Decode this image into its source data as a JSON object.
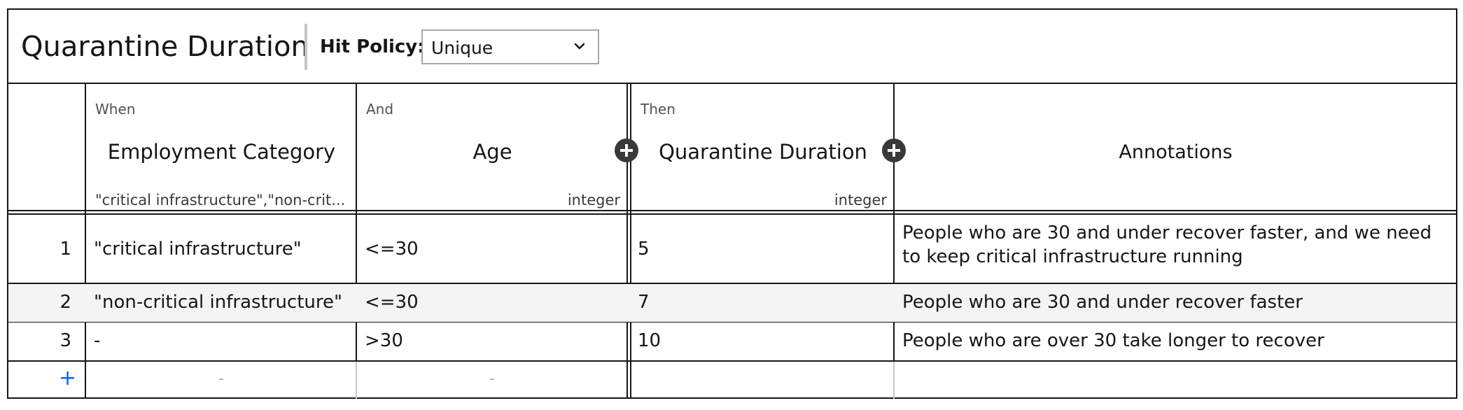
{
  "table_title": "Quarantine Duration",
  "hit_policy": {
    "label": "Hit Policy:",
    "value": "Unique"
  },
  "headers": {
    "when": {
      "label": "When",
      "name": "Employment Category",
      "type": "\"critical infrastructure\",\"non-crit..."
    },
    "and": {
      "label": "And",
      "name": "Age",
      "type": "integer"
    },
    "then": {
      "label": "Then",
      "name": "Quarantine Duration",
      "type": "integer"
    },
    "annotations": {
      "name": "Annotations"
    }
  },
  "rows": [
    {
      "num": "1",
      "employment": "\"critical infrastructure\"",
      "age": "<=30",
      "duration": "5",
      "annotation": "People who  are 30 and under recover faster, and we need to keep critical infrastructure running"
    },
    {
      "num": "2",
      "employment": "\"non-critical infrastructure\"",
      "age": "<=30",
      "duration": "7",
      "annotation": "People who  are 30 and under recover faster"
    },
    {
      "num": "3",
      "employment": "-",
      "age": ">30",
      "duration": "10",
      "annotation": "People who are over 30 take longer to recover"
    }
  ],
  "new_row": {
    "add": "+",
    "placeholder_1": "-",
    "placeholder_2": "-"
  },
  "icons": {
    "dropdown": "chevron-down-icon",
    "add_input": "add-circle-icon",
    "add_output": "add-circle-icon",
    "add_row": "plus-icon"
  },
  "colors": {
    "border": "#161616",
    "row_alt": "#f4f4f4",
    "accent": "#0f62fe",
    "icon": "#393939"
  }
}
